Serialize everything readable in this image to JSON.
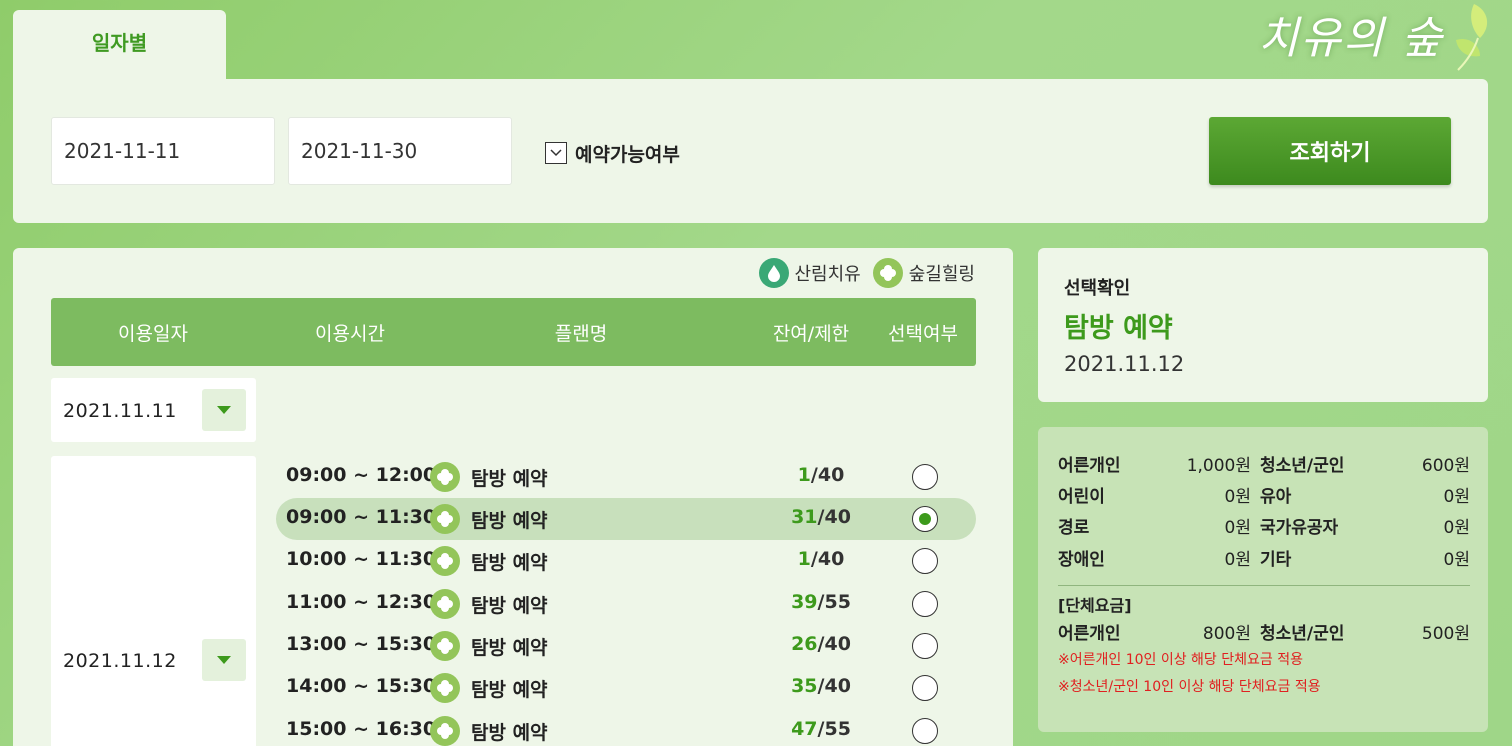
{
  "header": {
    "logo_text": "치유의 숲",
    "tab_label": "일자별"
  },
  "search": {
    "start_date": "2021-11-11",
    "end_date": "2021-11-30",
    "availability_label": "예약가능여부",
    "search_button": "조회하기"
  },
  "legend": {
    "forest_healing": "산림치유",
    "trail_healing": "숲길힐링"
  },
  "table": {
    "headers": [
      "이용일자",
      "이용시간",
      "플랜명",
      "잔여/제한",
      "선택여부"
    ]
  },
  "dates": [
    {
      "date": "2021.11.11"
    },
    {
      "date": "2021.11.12"
    }
  ],
  "sessions": [
    {
      "time": "09:00 ~ 12:00",
      "plan": "탐방 예약",
      "remain": "1",
      "sep": "/",
      "limit": "40",
      "selected": false
    },
    {
      "time": "09:00 ~ 11:30",
      "plan": "탐방 예약",
      "remain": "31",
      "sep": "/",
      "limit": "40",
      "selected": true
    },
    {
      "time": "10:00 ~ 11:30",
      "plan": "탐방 예약",
      "remain": "1",
      "sep": "/",
      "limit": "40",
      "selected": false
    },
    {
      "time": "11:00 ~ 12:30",
      "plan": "탐방 예약",
      "remain": "39",
      "sep": "/",
      "limit": "55",
      "selected": false
    },
    {
      "time": "13:00 ~ 15:30",
      "plan": "탐방 예약",
      "remain": "26",
      "sep": "/",
      "limit": "40",
      "selected": false
    },
    {
      "time": "14:00 ~ 15:30",
      "plan": "탐방 예약",
      "remain": "35",
      "sep": "/",
      "limit": "40",
      "selected": false
    },
    {
      "time": "15:00 ~ 16:30",
      "plan": "탐방 예약",
      "remain": "47",
      "sep": "/",
      "limit": "55",
      "selected": false
    }
  ],
  "confirm": {
    "label": "선택확인",
    "plan": "탐방 예약",
    "date": "2021.11.12"
  },
  "prices": {
    "individual": [
      {
        "label": "어른개인",
        "value": "1,000원"
      },
      {
        "label": "청소년/군인",
        "value": "600원"
      },
      {
        "label": "어린이",
        "value": "0원"
      },
      {
        "label": "유아",
        "value": "0원"
      },
      {
        "label": "경로",
        "value": "0원"
      },
      {
        "label": "국가유공자",
        "value": "0원"
      },
      {
        "label": "장애인",
        "value": "0원"
      },
      {
        "label": "기타",
        "value": "0원"
      }
    ],
    "group_title": "[단체요금]",
    "group": [
      {
        "label": "어른개인",
        "value": "800원"
      },
      {
        "label": "청소년/군인",
        "value": "500원"
      }
    ],
    "notes": [
      "※어른개인 10인 이상 해당 단체요금 적용",
      "※청소년/군인 10인 이상 해당 단체요금 적용"
    ]
  },
  "colors": {
    "accent_green": "#3d9a1c",
    "header_green": "#7dbb60",
    "note_red": "#e02020"
  }
}
